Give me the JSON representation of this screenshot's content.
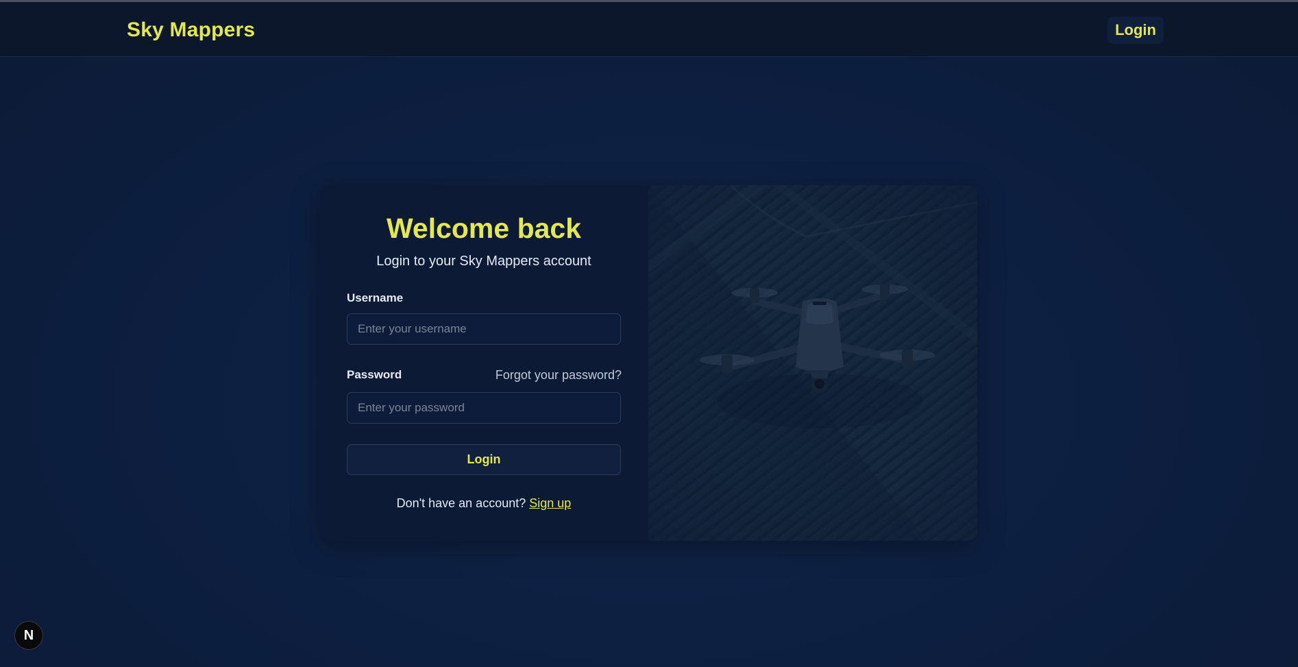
{
  "header": {
    "brand": "Sky Mappers",
    "login_label": "Login"
  },
  "form": {
    "title": "Welcome back",
    "subtitle": "Login to your Sky Mappers account",
    "username_label": "Username",
    "username_placeholder": "Enter your username",
    "username_value": "",
    "password_label": "Password",
    "forgot_label": "Forgot your password?",
    "password_placeholder": "Enter your password",
    "password_value": "",
    "submit_label": "Login",
    "signup_prompt": "Don't have an account?",
    "signup_label": "Sign up"
  },
  "badge": {
    "label": "N"
  },
  "colors": {
    "accent": "#e3e84f",
    "background": "#0d1f40",
    "card": "#0c1a36"
  }
}
